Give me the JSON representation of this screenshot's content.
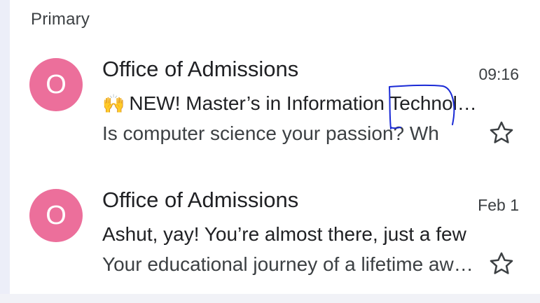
{
  "inbox": {
    "section": "Primary",
    "emails": [
      {
        "avatar_letter": "O",
        "sender": "Office of Admissions",
        "time": "09:16",
        "subject_emoji": "🙌",
        "subject": "NEW! Master’s in Information Technology",
        "snippet": "Is computer science your passion? Wh",
        "starred": false
      },
      {
        "avatar_letter": "O",
        "sender": "Office of Admissions",
        "time": "Feb 1",
        "subject": "Ashut, yay! You’re almost there, just a few",
        "snippet": "Your educational journey of a lifetime awaits",
        "starred": false
      }
    ]
  },
  "colors": {
    "avatar": "#ec6f9b",
    "annotation_ink": "#1a2ad6",
    "background": "#eceef8"
  },
  "icons": {
    "star": "star-outline-icon"
  }
}
